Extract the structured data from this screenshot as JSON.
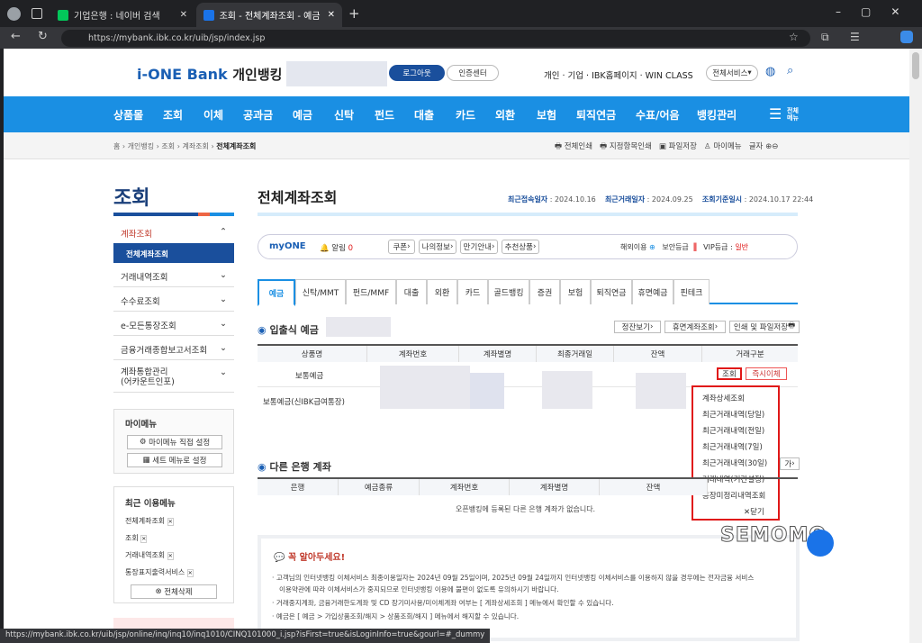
{
  "browser": {
    "tabs": [
      {
        "label": "기업은행 : 네이버 검색"
      },
      {
        "label": "조회 - 전체계좌조회 - 예금 | IBK"
      }
    ],
    "url": "https://mybank.ibk.co.kr/uib/jsp/index.jsp",
    "status_url": "https://mybank.ibk.co.kr/uib/jsp/online/inq/inq10/inq1010/CINQ101000_i.jsp?isFirst=true&isLoginInfo=true&gourl=#_dummy"
  },
  "header": {
    "logo": "i-ONE Bank",
    "logo_sub": "개인뱅킹",
    "logout": "로그아웃",
    "cert": "인증센터",
    "links": [
      "개인",
      "기업",
      "IBK홈페이지",
      "WIN CLASS"
    ],
    "all_services": "전체서비스"
  },
  "gnb": [
    "상품몰",
    "조회",
    "이체",
    "공과금",
    "예금",
    "신탁",
    "펀드",
    "대출",
    "카드",
    "외환",
    "보험",
    "퇴직연금",
    "수표/어음",
    "뱅킹관리"
  ],
  "gnb_all": "전체메뉴",
  "breadcrumb": [
    "홈",
    "개인뱅킹",
    "조회",
    "계좌조회",
    "전체계좌조회"
  ],
  "utils": [
    "전체인쇄",
    "지정항목인쇄",
    "파일저장",
    "마이메뉴"
  ],
  "font_label": "글자",
  "sidebar": {
    "title": "조회",
    "items": [
      "계좌조회",
      "전체계좌조회",
      "거래내역조회",
      "수수료조회",
      "e-모든통장조회",
      "금융거래종합보고서조회",
      "계좌통합관리\n(어카운트인포)"
    ],
    "mymenu": {
      "title": "마이메뉴",
      "btn1": "마이메뉴 직접 설정",
      "btn2": "세트 메뉴로 설정"
    },
    "recent": {
      "title": "최근 이용메뉴",
      "items": [
        "전체계좌조회",
        "조회",
        "거래내역조회",
        "통장표지출력서비스"
      ],
      "delete": "전체삭제"
    }
  },
  "main": {
    "title": "전체계좌조회",
    "last_access_label": "최근접속일자",
    "last_access": "2024.10.16",
    "last_trans_label": "최근거래일자",
    "last_trans": "2024.09.25",
    "base_label": "조회기준일시",
    "base": "2024.10.17 22:44"
  },
  "myone": {
    "logo": "myONE",
    "alarm_label": "알림",
    "alarm_count": "0",
    "chips": [
      "쿠폰",
      "나의정보",
      "만기안내",
      "추천상품"
    ],
    "overseas": "해외이용",
    "security": "보안등급",
    "vip": "VIP등급",
    "vip_value": "일반"
  },
  "tabs": [
    "예금",
    "신탁/MMT",
    "펀드/MMF",
    "대출",
    "외환",
    "카드",
    "골드뱅킹",
    "증권",
    "보험",
    "퇴직연금",
    "휴면예금",
    "핀테크"
  ],
  "deposit": {
    "title": "입출식 예금",
    "btns": [
      "정잔보기",
      "휴면계좌조회",
      "인쇄 및 파일저장"
    ],
    "cols": [
      "상품명",
      "계좌번호",
      "계좌별명",
      "최종거래일",
      "잔액",
      "거래구분"
    ],
    "rows": [
      "보통예금",
      "보통예금(신IBK급여통장)"
    ],
    "row_btns": [
      "조회",
      "즉시이체"
    ]
  },
  "popup": [
    "계좌상세조회",
    "최근거래내역(당일)",
    "최근거래내역(전일)",
    "최근거래내역(7일)",
    "최근거래내역(30일)",
    "거래내역(기간설정)",
    "통장미정리내역조회",
    "닫기"
  ],
  "other": {
    "title": "다른 은행 계좌",
    "cols": [
      "은행",
      "예금종류",
      "계좌번호",
      "계좌별명",
      "잔액"
    ],
    "empty": "오픈뱅킹에 등록된 다른 은행 계좌가 없습니다.",
    "more": "가"
  },
  "notice": {
    "title": "꼭 알아두세요!",
    "lines": [
      "고객님의 인터넷뱅킹 이체서비스 최종이용일자는 2024년 09월 25일이며, 2025년 09월 24일까지 인터넷뱅킹 이체서비스를 이용하지 않을 경우에는 전자금융 서비스",
      "이용약관에 따라 이체서비스가 중지되므로 인터넷뱅킹 이용에 불편이 없도록 유의하시기 바랍니다.",
      "거래중지계좌, 금융거래한도계좌 및 CD 장기미사용/미이체계좌 여부는 [ 계좌상세조회 ] 메뉴에서 확인할 수 있습니다.",
      "예금은 [ 예금 > 가입상품조회/해지 > 상품조회/해지 ] 메뉴에서 해지할 수 있습니다."
    ]
  },
  "watermark": "SEMOMO"
}
